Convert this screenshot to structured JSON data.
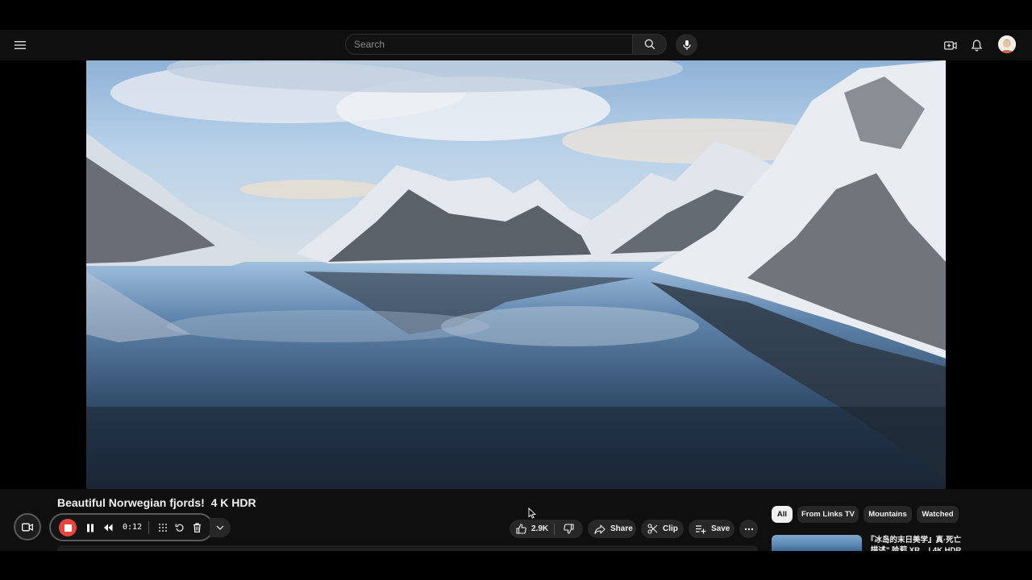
{
  "header": {
    "search_placeholder": "Search",
    "icons": [
      "menu-icon",
      "search-icon",
      "mic-icon",
      "create-icon",
      "bell-icon",
      "avatar"
    ]
  },
  "video": {
    "title": "Beautiful Norwegian fjords!  4 K HDR"
  },
  "recorder": {
    "timer": "0:12",
    "accent_color": "#e8463c"
  },
  "actions": {
    "like_count": "2.9K",
    "share_label": "Share",
    "clip_label": "Clip",
    "save_label": "Save"
  },
  "chips": [
    {
      "label": "All",
      "active": true
    },
    {
      "label": "From Links TV",
      "active": false
    },
    {
      "label": "Mountains",
      "active": false
    },
    {
      "label": "Watched",
      "active": false
    }
  ],
  "recommendation": {
    "title": "『冰岛的末日美学』真·死亡 „描述” 哈莉 XR... | 4K HDR"
  }
}
